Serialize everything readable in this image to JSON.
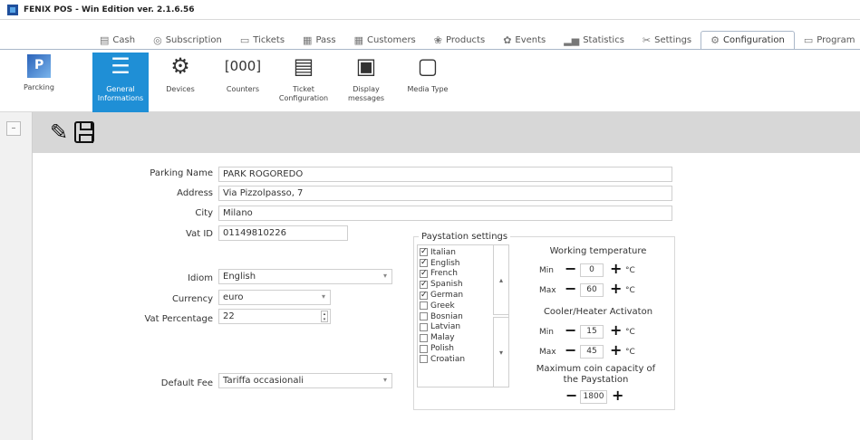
{
  "app": {
    "title": "FENIX POS - Win Edition ver. 2.1.6.56"
  },
  "tabs": [
    {
      "label": "Cash",
      "icon": "cash-icon"
    },
    {
      "label": "Subscription",
      "icon": "subscription-icon"
    },
    {
      "label": "Tickets",
      "icon": "tickets-icon"
    },
    {
      "label": "Pass",
      "icon": "pass-icon"
    },
    {
      "label": "Customers",
      "icon": "customers-icon"
    },
    {
      "label": "Products",
      "icon": "products-icon"
    },
    {
      "label": "Events",
      "icon": "events-icon"
    },
    {
      "label": "Statistics",
      "icon": "statistics-icon"
    },
    {
      "label": "Settings",
      "icon": "settings-icon"
    },
    {
      "label": "Configuration",
      "icon": "configuration-icon"
    },
    {
      "label": "Program",
      "icon": "program-icon"
    }
  ],
  "ribbon": {
    "parking_label": "Parcking",
    "items": [
      {
        "label": "General Informations",
        "icon": "sliders-icon"
      },
      {
        "label": "Devices",
        "icon": "devices-icon"
      },
      {
        "label": "Counters",
        "icon": "counter-icon"
      },
      {
        "label": "Ticket Configuration",
        "icon": "ticket-config-icon"
      },
      {
        "label": "Display messages",
        "icon": "display-icon"
      },
      {
        "label": "Media Type",
        "icon": "media-icon"
      }
    ]
  },
  "form": {
    "parking_name_label": "Parking Name",
    "parking_name": "PARK ROGOREDO",
    "address_label": "Address",
    "address": "Via Pizzolpasso, 7",
    "city_label": "City",
    "city": "Milano",
    "vat_id_label": "Vat ID",
    "vat_id": "01149810226",
    "idiom_label": "Idiom",
    "idiom": "English",
    "currency_label": "Currency",
    "currency": "euro",
    "vat_percentage_label": "Vat Percentage",
    "vat_percentage": "22",
    "default_fee_label": "Default Fee",
    "default_fee": "Tariffa occasionali"
  },
  "paystation": {
    "title": "Paystation settings",
    "languages": [
      {
        "label": "Italian",
        "checked": true
      },
      {
        "label": "English",
        "checked": true
      },
      {
        "label": "French",
        "checked": true
      },
      {
        "label": "Spanish",
        "checked": true
      },
      {
        "label": "German",
        "checked": true
      },
      {
        "label": "Greek",
        "checked": false
      },
      {
        "label": "Bosnian",
        "checked": false
      },
      {
        "label": "Latvian",
        "checked": false
      },
      {
        "label": "Malay",
        "checked": false
      },
      {
        "label": "Polish",
        "checked": false
      },
      {
        "label": "Croatian",
        "checked": false
      }
    ],
    "working_temp_title": "Working temperature",
    "min_label": "Min",
    "max_label": "Max",
    "unit": "°C",
    "work_min": "0",
    "work_max": "60",
    "cooler_title": "Cooler/Heater Activaton",
    "cooler_min": "15",
    "cooler_max": "45",
    "coin_title": "Maximum coin capacity of the Paystation",
    "coin_value": "1800"
  },
  "colors": {
    "accent": "#1f8fd6",
    "toolbar": "#d7d7d7"
  }
}
